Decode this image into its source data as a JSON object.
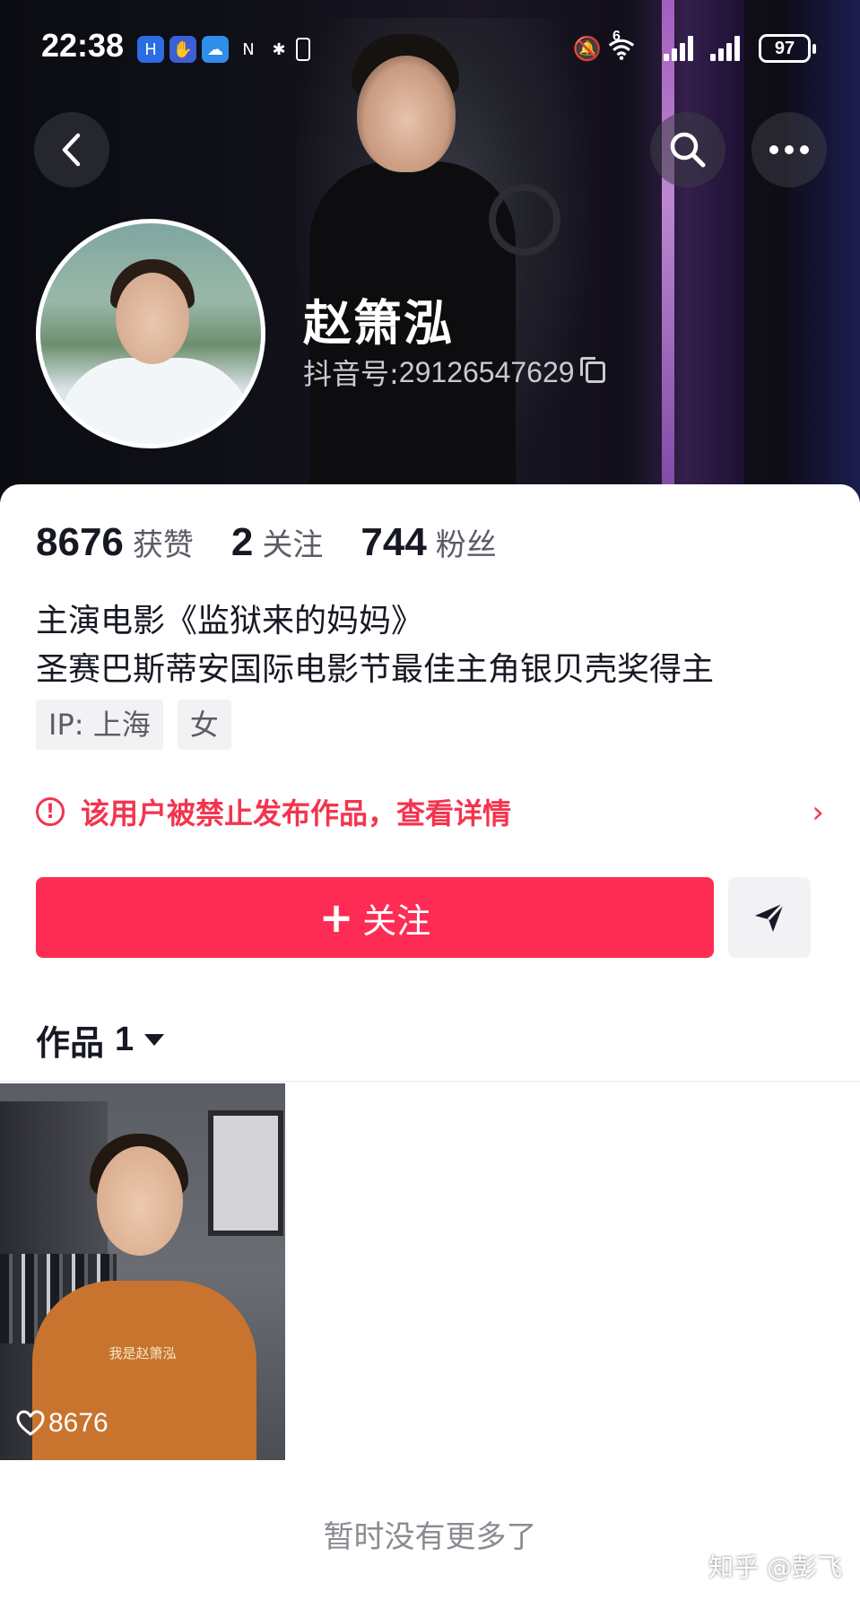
{
  "status_bar": {
    "time": "22:38",
    "battery": "97",
    "network": "6"
  },
  "header": {
    "back_icon": "chevron-left-icon",
    "search_icon": "search-icon",
    "more_icon": "more-dots-icon"
  },
  "profile": {
    "name": "赵箫泓",
    "douyin_id_label": "抖音号: ",
    "douyin_id": "29126547629",
    "stats": [
      {
        "value": "8676",
        "label": "获赞"
      },
      {
        "value": "2",
        "label": "关注"
      },
      {
        "value": "744",
        "label": "粉丝"
      }
    ],
    "bio_lines": [
      "主演电影《监狱来的妈妈》",
      "圣赛巴斯蒂安国际电影节最佳主角银贝壳奖得主"
    ],
    "tags": [
      "IP: 上海",
      "女"
    ]
  },
  "ban_notice": {
    "text": "该用户被禁止发布作品，查看详情",
    "color": "#f3344e"
  },
  "actions": {
    "follow_label": "关注",
    "follow_plus": "+",
    "follow_color": "#fe2c55",
    "share_icon": "send-icon"
  },
  "works": {
    "tab_label": "作品",
    "count": "1",
    "items": [
      {
        "caption": "我是赵箫泓",
        "likes": "8676"
      }
    ]
  },
  "footer": {
    "no_more": "暂时没有更多了",
    "watermark": "知乎 @彭飞"
  }
}
